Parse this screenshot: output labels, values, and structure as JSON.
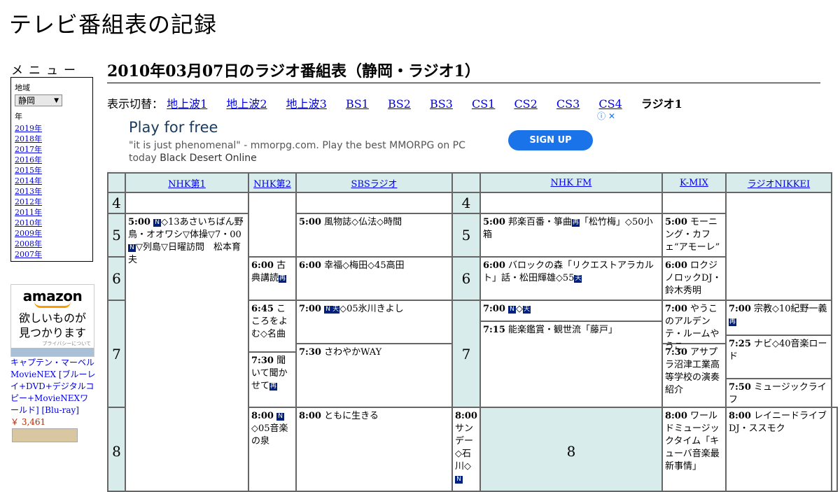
{
  "site_title": "テレビ番組表の記録",
  "menu": {
    "heading": "メニュー",
    "region_label": "地域",
    "region_value": "静岡",
    "year_label": "年",
    "years": [
      "2019年",
      "2018年",
      "2017年",
      "2016年",
      "2015年",
      "2014年",
      "2013年",
      "2012年",
      "2011年",
      "2010年",
      "2009年",
      "2008年",
      "2007年"
    ]
  },
  "amazon": {
    "logo": "amazon",
    "tagline_1": "欲しいものが",
    "tagline_2": "見つかります",
    "privacy": "プライバシーについて",
    "product": "キャプテン・マーベル MovieNEX [ブルーレイ+DVD+デジタルコピー+MovieNEXワールド] [Blu-ray]",
    "price": "￥ 3,461"
  },
  "page_title": "2010年03月07日のラジオ番組表（静岡・ラジオ1）",
  "switcher": {
    "label": "表示切替：",
    "tabs": [
      "地上波1",
      "地上波2",
      "地上波3",
      "BS1",
      "BS2",
      "BS3",
      "CS1",
      "CS2",
      "CS3",
      "CS4"
    ],
    "current": "ラジオ1"
  },
  "ad": {
    "title": "Play for free",
    "body": "\"it is just phenomenal\" - mmorpg.com. Play the best MMORPG on PC today",
    "body_bold": "Black Desert Online",
    "button": "SIGN UP",
    "icons": "ⓘ ✕"
  },
  "channels": [
    "NHK第1",
    "NHK第2",
    "SBSラジオ",
    "NHK FM",
    "K-MIX",
    "ラジオNIKKEI"
  ],
  "hours": [
    "4",
    "5",
    "6",
    "7",
    "8"
  ],
  "programs": {
    "nhk1_500_time": "5:00",
    "nhk1_500_a": "◇13あさいちばん野鳥・オオワシ▽体操▽7・00",
    "nhk1_500_b": "▽列島▽日曜訪問　松本育夫",
    "nhk1_800_time": "8:00",
    "nhk1_800": "◇05音楽の泉",
    "nhk2_600_time": "6:00",
    "nhk2_600": "古典講読",
    "nhk2_645_time": "6:45",
    "nhk2_645": "こころをよむ◇名曲",
    "nhk2_730_time": "7:30",
    "nhk2_730": "聞いて聞かせて",
    "nhk2_800_time": "8:00",
    "nhk2_800": "ともに生きる",
    "sbs_500_time": "5:00",
    "sbs_500": "風物誌◇仏法◇時間",
    "sbs_600_time": "6:00",
    "sbs_600": "幸福◇梅田◇45高田",
    "sbs_700_time": "7:00",
    "sbs_700": "◇05氷川きよし",
    "sbs_730_time": "7:30",
    "sbs_730": "さわやかWAY",
    "sbs_800_time": "8:00",
    "sbs_800": "サンデー◇石川◇",
    "fm_500_time": "5:00",
    "fm_500_a": "邦楽百番・箏曲",
    "fm_500_b": "「松竹梅」◇50小箱",
    "fm_600_time": "6:00",
    "fm_600": "バロックの森「リクエストアラカルト」話・松田輝雄◇55",
    "fm_700_time": "7:00",
    "fm_700": "◇",
    "fm_715_time": "7:15",
    "fm_715": "能楽鑑賞・観世流「藤戸」",
    "fm_800_time": "8:00",
    "fm_800": "ワールドミュージックタイム「キューバ音楽最新事情」",
    "kmix_500_time": "5:00",
    "kmix_500": "モーニング・カフェ“アモーレ”",
    "kmix_600_time": "6:00",
    "kmix_600": "ロクジノロックDJ・鈴木秀明",
    "kmix_700_time": "7:00",
    "kmix_700": "やうこのアルデンテ・ルームやうこ",
    "kmix_730_time": "7:30",
    "kmix_730": "アサプラ沼津工業高等学校の演奏紹介",
    "kmix_800_time": "8:00",
    "kmix_800": "レイニードライブDJ・ススモク",
    "nikkei_700_time": "7:00",
    "nikkei_700": "宗教◇10紀野一義",
    "nikkei_725_time": "7:25",
    "nikkei_725": "ナビ◇40音楽ロード",
    "nikkei_750_time": "7:50",
    "nikkei_750": "ミュージックライフ"
  },
  "icon_labels": {
    "news": "N",
    "weather": "天",
    "rerun": "再"
  }
}
